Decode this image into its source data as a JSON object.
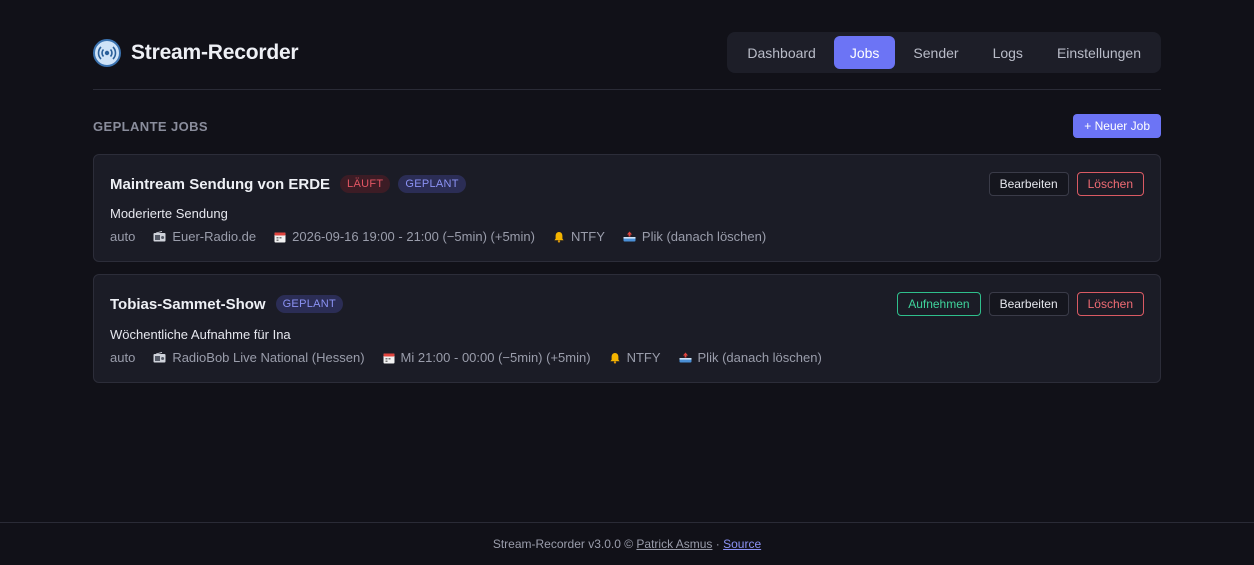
{
  "app": {
    "title": "Stream-Recorder"
  },
  "nav": {
    "items": [
      {
        "label": "Dashboard"
      },
      {
        "label": "Jobs"
      },
      {
        "label": "Sender"
      },
      {
        "label": "Logs"
      },
      {
        "label": "Einstellungen"
      }
    ],
    "active": "Jobs"
  },
  "section": {
    "title": "GEPLANTE JOBS",
    "new_job_label": "+ Neuer Job"
  },
  "jobs": [
    {
      "title": "Maintream Sendung von ERDE",
      "badges": [
        "LÄUFT",
        "GEPLANT"
      ],
      "description": "Moderierte Sendung",
      "mode": "auto",
      "station": "Euer-Radio.de",
      "schedule": "2026-09-16 19:00 - 21:00 (−5min) (+5min)",
      "notify": "NTFY",
      "upload": "Plik (danach löschen)",
      "edit_label": "Bearbeiten",
      "delete_label": "Löschen"
    },
    {
      "title": "Tobias-Sammet-Show",
      "badges": [
        "GEPLANT"
      ],
      "description": "Wöchentliche Aufnahme für Ina",
      "mode": "auto",
      "station": "RadioBob Live National (Hessen)",
      "schedule": "Mi 21:00 - 00:00 (−5min) (+5min)",
      "notify": "NTFY",
      "upload": "Plik (danach löschen)",
      "record_label": "Aufnehmen",
      "edit_label": "Bearbeiten",
      "delete_label": "Löschen"
    }
  ],
  "footer": {
    "prefix": "Stream-Recorder v3.0.0 © ",
    "author": "Patrick Asmus",
    "separator": " · ",
    "source": "Source"
  },
  "icons": {
    "brand": "radio-tower-icon",
    "station": "radio-icon",
    "schedule": "calendar-icon",
    "notify": "bell-icon",
    "upload": "upload-tray-icon"
  },
  "colors": {
    "background": "#111118",
    "accent": "#6c74f5",
    "running": "#e25563",
    "record": "#3fd39b",
    "delete": "#ef6b74"
  }
}
